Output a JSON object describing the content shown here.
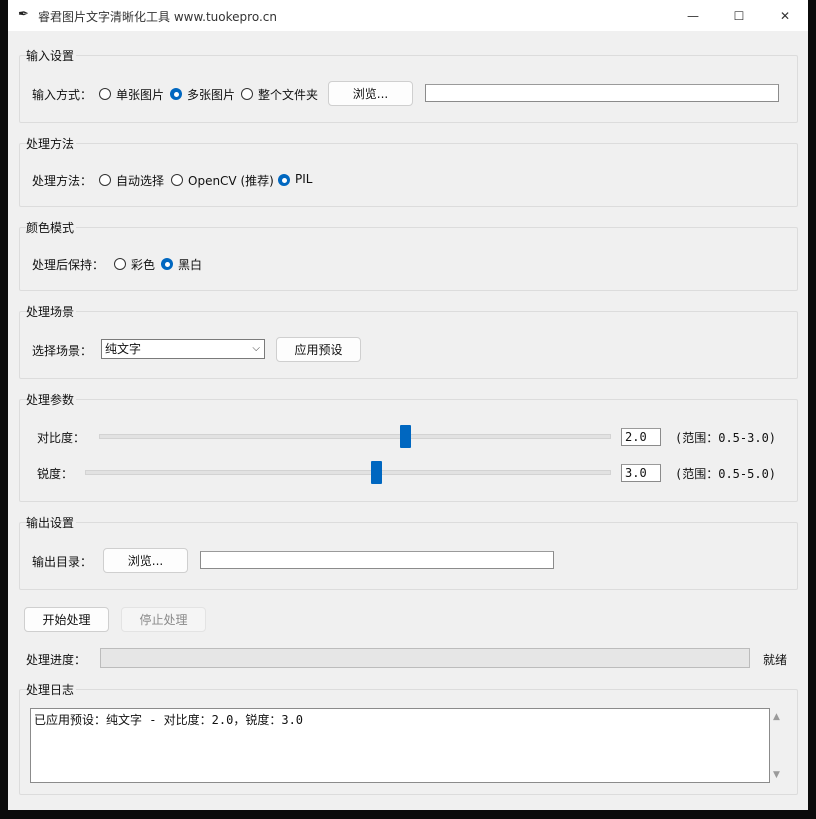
{
  "window": {
    "title": "睿君图片文字清晰化工具 www.tuokepro.cn",
    "icon": "feather-icon",
    "minimize_glyph": "—",
    "maximize_glyph": "☐",
    "close_glyph": "✕"
  },
  "input_settings": {
    "group_title": "输入设置",
    "mode_label": "输入方式：",
    "options": [
      "单张图片",
      "多张图片",
      "整个文件夹"
    ],
    "selected": "多张图片",
    "browse_label": "浏览...",
    "path_value": ""
  },
  "method": {
    "group_title": "处理方法",
    "label": "处理方法：",
    "options": [
      "自动选择",
      "OpenCV (推荐)",
      "PIL"
    ],
    "selected": "PIL"
  },
  "color_mode": {
    "group_title": "颜色模式",
    "label": "处理后保持：",
    "options": [
      "彩色",
      "黑白"
    ],
    "selected": "黑白"
  },
  "scene": {
    "group_title": "处理场景",
    "label": "选择场景：",
    "selected": "纯文字",
    "apply_label": "应用预设"
  },
  "params": {
    "group_title": "处理参数",
    "contrast": {
      "label": "对比度：",
      "value": "2.0",
      "range_text": "(范围：0.5-3.0)",
      "min": 0.5,
      "max": 3.0,
      "current": 2.0
    },
    "sharpness": {
      "label": "锐度：",
      "value": "3.0",
      "range_text": "(范围：0.5-5.0)",
      "min": 0.5,
      "max": 5.0,
      "current": 3.0
    }
  },
  "output": {
    "group_title": "输出设置",
    "dir_label": "输出目录：",
    "browse_label": "浏览...",
    "path_value": ""
  },
  "actions": {
    "start_label": "开始处理",
    "stop_label": "停止处理"
  },
  "progress": {
    "label": "处理进度：",
    "value": 0,
    "status": "就绪"
  },
  "log": {
    "group_title": "处理日志",
    "text": "已应用预设：纯文字 - 对比度：2.0，锐度：3.0"
  },
  "colors": {
    "accent": "#0067c0",
    "window_bg": "#f0f0f0"
  }
}
